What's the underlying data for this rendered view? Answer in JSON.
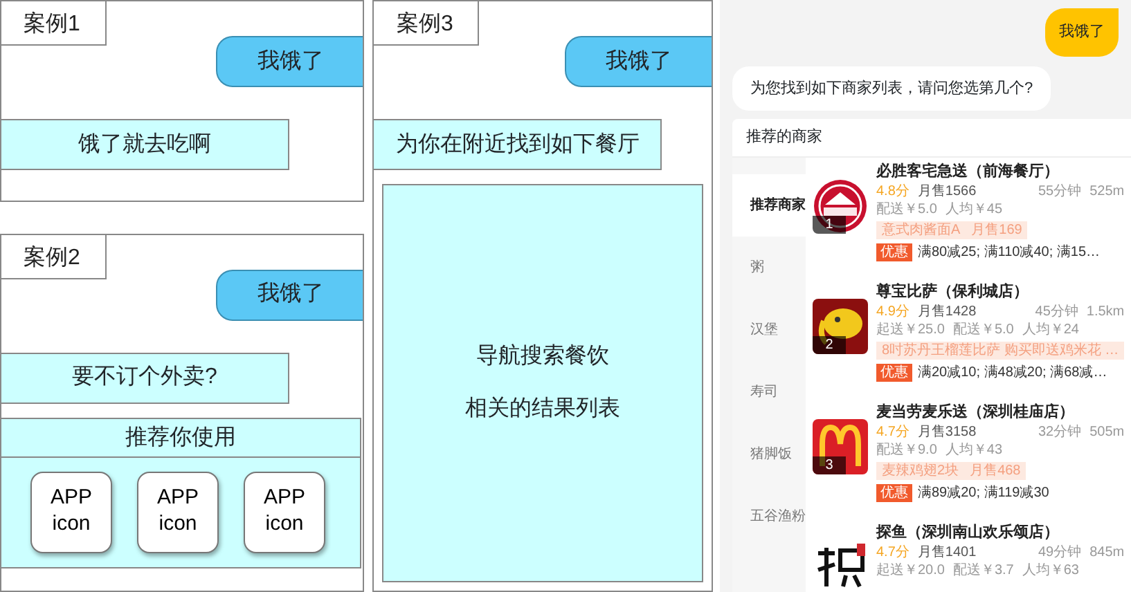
{
  "cases": [
    {
      "title": "案例1",
      "items": [
        {
          "kind": "user_bubble",
          "text": "我饿了"
        },
        {
          "kind": "bot_reply",
          "text": "饿了就去吃啊"
        }
      ]
    },
    {
      "title": "案例2",
      "items": [
        {
          "kind": "user_bubble",
          "text": "我饿了"
        },
        {
          "kind": "bot_reply",
          "text": "要不订个外卖?"
        },
        {
          "kind": "app_panel",
          "title": "推荐你使用",
          "apps": [
            "APP icon",
            "APP icon",
            "APP icon"
          ]
        }
      ]
    },
    {
      "title": "案例3",
      "items": [
        {
          "kind": "user_bubble",
          "text": "我饿了"
        },
        {
          "kind": "bot_reply",
          "text": "为你在附近找到如下餐厅"
        },
        {
          "kind": "result_panel",
          "lines": [
            "导航搜索餐饮",
            "相关的结果列表"
          ]
        }
      ]
    }
  ],
  "chat": {
    "user_message": "我饿了",
    "bot_message": "为您找到如下商家列表，请问您选第几个?",
    "card": {
      "title": "推荐的商家",
      "categories": [
        {
          "label": "推荐商家",
          "selected": true
        },
        {
          "label": "粥",
          "selected": false
        },
        {
          "label": "汉堡",
          "selected": false
        },
        {
          "label": "寿司",
          "selected": false
        },
        {
          "label": "猪脚饭",
          "selected": false
        },
        {
          "label": "五谷渔粉",
          "selected": false
        }
      ],
      "merchants": [
        {
          "rank": "1",
          "kind": "pizza",
          "name": "必胜客宅急送（前海餐厅）",
          "score": "4.8分",
          "sales": "月售1566",
          "time": "55分钟",
          "distance": "525m",
          "fees": [
            "配送￥5.0",
            "人均￥45"
          ],
          "dish": "意式肉酱面A",
          "dish_sales": "月售169",
          "promo_badge": "优惠",
          "promo": "满80减25; 满110减40; 满15…"
        },
        {
          "rank": "2",
          "kind": "elephant",
          "name": "尊宝比萨（保利城店）",
          "score": "4.9分",
          "sales": "月售1428",
          "time": "45分钟",
          "distance": "1.5km",
          "fees": [
            "起送￥25.0",
            "配送￥5.0",
            "人均￥24"
          ],
          "dish": "8吋苏丹王榴莲比萨 购买即送鸡米花 …",
          "promo_badge": "优惠",
          "promo": "满20减10; 满48减20; 满68减…"
        },
        {
          "rank": "3",
          "kind": "arches",
          "name": "麦当劳麦乐送（深圳桂庙店）",
          "score": "4.7分",
          "sales": "月售3158",
          "time": "32分钟",
          "distance": "505m",
          "fees": [
            "配送￥9.0",
            "人均￥43"
          ],
          "dish": "麦辣鸡翅2块",
          "dish_sales": "月售468",
          "promo_badge": "优惠",
          "promo": "满89减20; 满119减30"
        },
        {
          "kind": "brush",
          "name": "探鱼（深圳南山欢乐颂店）",
          "score": "4.7分",
          "sales": "月售1401",
          "time": "49分钟",
          "distance": "845m",
          "fees": [
            "起送￥20.0",
            "配送￥3.7",
            "人均￥63"
          ]
        }
      ]
    }
  }
}
